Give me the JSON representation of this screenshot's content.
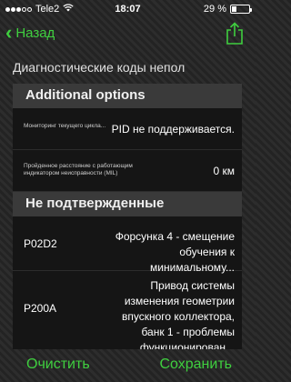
{
  "status_bar": {
    "carrier": "Tele2",
    "time": "18:07",
    "battery_text": "29 %",
    "battery_level": 0.29
  },
  "nav": {
    "back_label": "Назад",
    "accent_color": "#3fcf3f"
  },
  "page": {
    "title": "Диагностические коды непол"
  },
  "additional_options": {
    "header": "Additional options",
    "rows": [
      {
        "label": "Мониторинг текущего цикла...",
        "value": "PID не поддерживается."
      },
      {
        "label": "Пройденное расстояние с работающим индикатором неисправности (MIL)",
        "value": "0 км"
      }
    ]
  },
  "unconfirmed": {
    "header": "Не подтвержденные",
    "codes": [
      {
        "code": "P02D2",
        "description": "Форсунка 4 - смещение обучения к минимальному..."
      },
      {
        "code": "P200A",
        "description": "Привод системы изменения геометрии впускного коллектора, банк 1 - проблемы функционирован..."
      }
    ]
  },
  "bottom": {
    "clear_label": "Очистить",
    "save_label": "Сохранить"
  }
}
